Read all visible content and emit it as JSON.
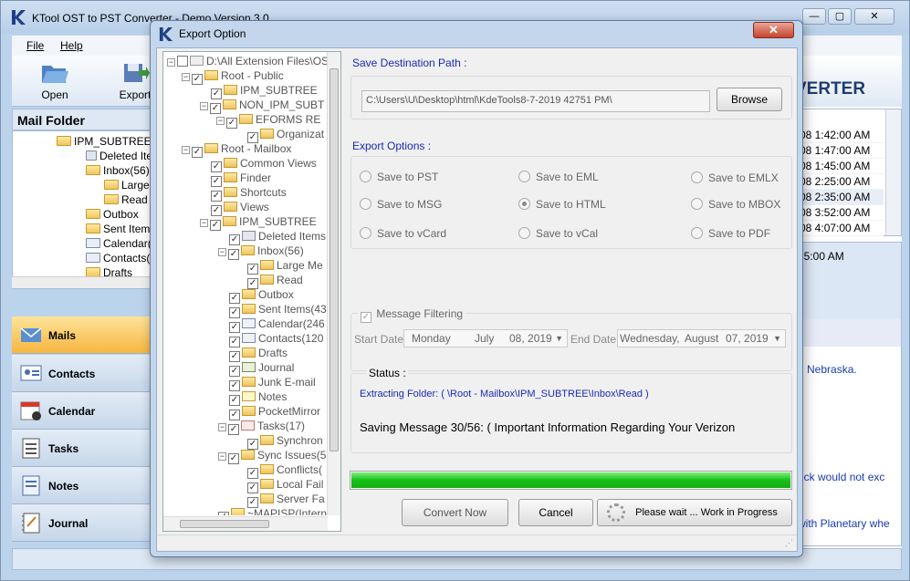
{
  "main": {
    "title": "KTool OST to PST Converter - Demo Version 3.0",
    "menu": [
      "File",
      "Help"
    ],
    "toolbar": [
      "Open",
      "Export"
    ],
    "mail_folder_title": "Mail Folder",
    "folders": [
      {
        "label": "IPM_SUBTREE"
      },
      {
        "label": "Deleted Items"
      },
      {
        "label": "Inbox(56)"
      },
      {
        "label": "Large"
      },
      {
        "label": "Read"
      },
      {
        "label": "Outbox"
      },
      {
        "label": "Sent Items"
      },
      {
        "label": "Calendar(2"
      },
      {
        "label": "Contacts(1"
      },
      {
        "label": "Drafts"
      }
    ],
    "nav": [
      "Mails",
      "Contacts",
      "Calendar",
      "Tasks",
      "Notes",
      "Journal"
    ],
    "banner": "VERTER",
    "mail_times": [
      "08 1:42:00 AM",
      "08 1:47:00 AM",
      "08 1:45:00 AM",
      "08 2:25:00 AM",
      "08 2:35:00 AM",
      "08 3:52:00 AM",
      "08 4:07:00 AM"
    ],
    "preview_time": "35:00 AM",
    "preview_lines": [
      "n Nebraska.",
      "uck would not exc",
      "with Planetary whe"
    ]
  },
  "dialog": {
    "title": "Export Option",
    "close_label": "✕",
    "tree": [
      {
        "label": "D:\\All Extension Files\\OST"
      },
      {
        "label": "Root - Public"
      },
      {
        "label": "IPM_SUBTREE"
      },
      {
        "label": "NON_IPM_SUBT"
      },
      {
        "label": "EFORMS RE"
      },
      {
        "label": "Organizat"
      },
      {
        "label": "Root - Mailbox"
      },
      {
        "label": "Common Views"
      },
      {
        "label": "Finder"
      },
      {
        "label": "Shortcuts"
      },
      {
        "label": "Views"
      },
      {
        "label": "IPM_SUBTREE"
      },
      {
        "label": "Deleted Items"
      },
      {
        "label": "Inbox(56)"
      },
      {
        "label": "Large Me"
      },
      {
        "label": "Read"
      },
      {
        "label": "Outbox"
      },
      {
        "label": "Sent Items(43"
      },
      {
        "label": "Calendar(246"
      },
      {
        "label": "Contacts(120"
      },
      {
        "label": "Drafts"
      },
      {
        "label": "Journal"
      },
      {
        "label": "Junk E-mail"
      },
      {
        "label": "Notes"
      },
      {
        "label": "PocketMirror"
      },
      {
        "label": "Tasks(17)"
      },
      {
        "label": "Synchron"
      },
      {
        "label": "Sync Issues(5"
      },
      {
        "label": "Conflicts("
      },
      {
        "label": "Local Fail"
      },
      {
        "label": "Server Fa"
      },
      {
        "label": "~MAPISP(Interna"
      }
    ],
    "save_dest_label": "Save Destination Path :",
    "dest_path": "C:\\Users\\U\\Desktop\\html\\KdeTools8-7-2019 42751 PM\\",
    "browse_label": "Browse",
    "export_options_label": "Export Options :",
    "options": [
      {
        "label": "Save to PST",
        "selected": false
      },
      {
        "label": "Save to EML",
        "selected": false
      },
      {
        "label": "Save to EMLX",
        "selected": false
      },
      {
        "label": "Save to MSG",
        "selected": false
      },
      {
        "label": "Save to HTML",
        "selected": true
      },
      {
        "label": "Save to MBOX",
        "selected": false
      },
      {
        "label": "Save to vCard",
        "selected": false
      },
      {
        "label": "Save to vCal",
        "selected": false
      },
      {
        "label": "Save to PDF",
        "selected": false
      }
    ],
    "filter_label": "Message Filtering",
    "start_date_label": "Start Date",
    "start_date": {
      "day": "Monday",
      "month": "July",
      "date": "08, 2019"
    },
    "end_date_label": "End Date",
    "end_date": {
      "day": "Wednesday,",
      "month": "August",
      "date": "07, 2019"
    },
    "status_label": "Status :",
    "extracting": "Extracting Folder: ( \\Root - Mailbox\\IPM_SUBTREE\\Inbox\\Read )",
    "saving": "Saving Message 30/56: ( Important Information Regarding Your Verizon",
    "progress": 1.0,
    "convert_label": "Convert Now",
    "cancel_label": "Cancel",
    "wait_label": "Please wait ... Work in Progress"
  }
}
